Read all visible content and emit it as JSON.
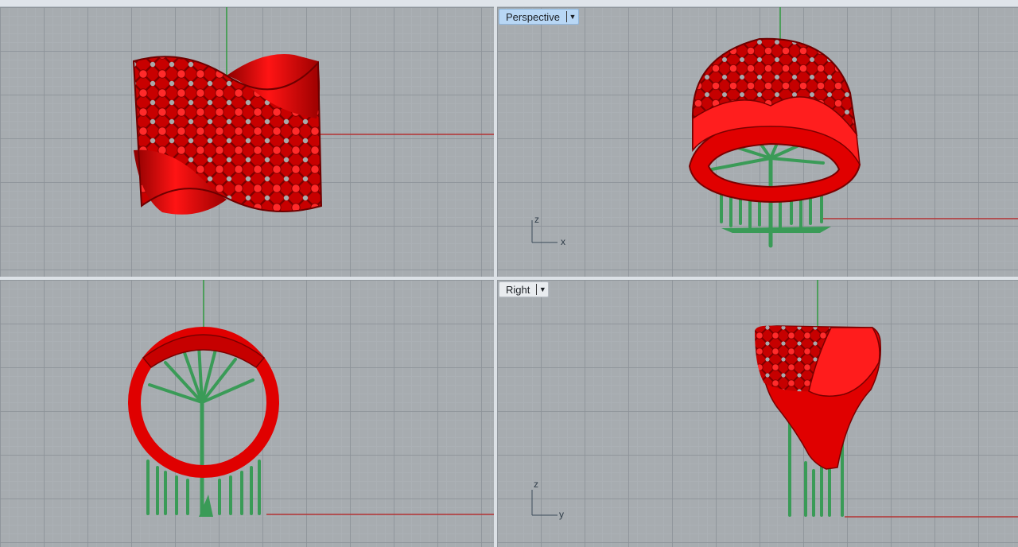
{
  "viewports": {
    "top_left": {
      "label": ""
    },
    "top_right": {
      "label": "Perspective",
      "active": true,
      "axes": {
        "vertical": "z",
        "horizontal": "x"
      }
    },
    "bottom_left": {
      "label": ""
    },
    "bottom_right": {
      "label": "Right",
      "active": false,
      "axes": {
        "vertical": "z",
        "horizontal": "y"
      }
    }
  },
  "colors": {
    "grid_bg": "#a7acb0",
    "model_red": "#e00000",
    "support_green": "#3a9b57",
    "axis_x_red": "#b33232",
    "axis_y_green": "#2f9a3f",
    "active_tab": "#b8d7f5"
  },
  "icons": {
    "dropdown": "chevron-down-icon",
    "axis_widget": "axis-triad-icon"
  }
}
